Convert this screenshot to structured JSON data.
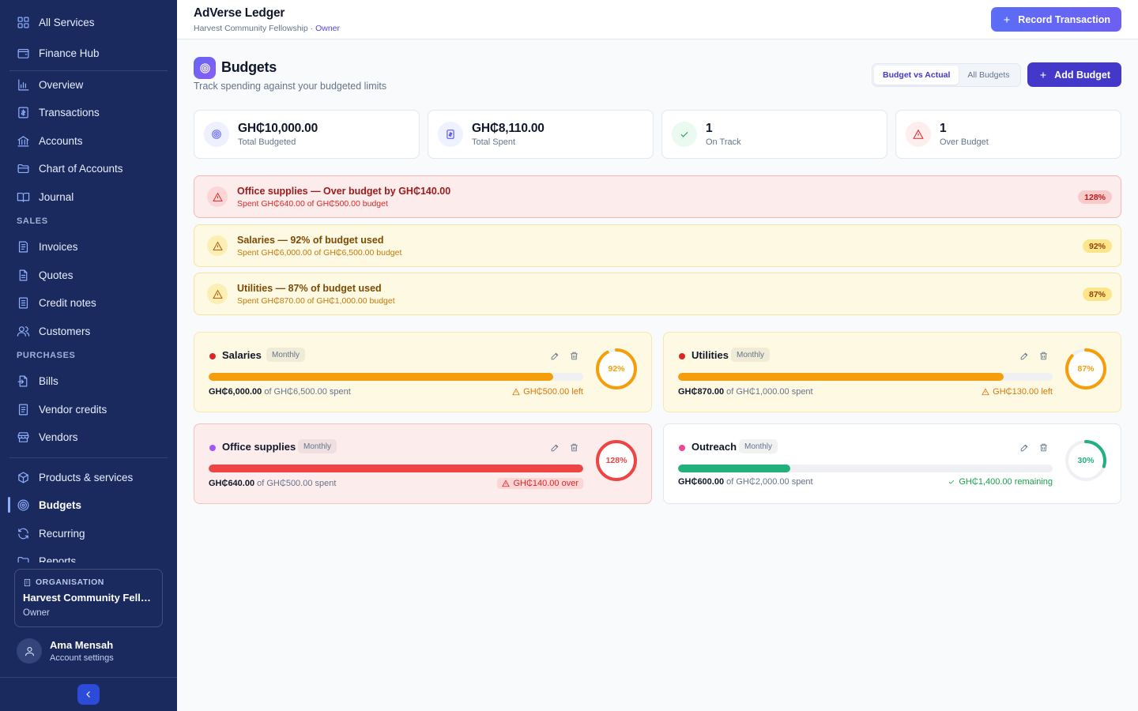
{
  "sidebar": {
    "items": [
      {
        "label": "All Services",
        "icon": "grid-icon"
      },
      {
        "label": "Finance Hub",
        "icon": "wallet-icon"
      },
      {
        "label": "Overview",
        "icon": "bar-chart-icon"
      },
      {
        "label": "Transactions",
        "icon": "receipt-icon"
      },
      {
        "label": "Accounts",
        "icon": "bank-icon"
      },
      {
        "label": "Chart of Accounts",
        "icon": "folder-icon"
      },
      {
        "label": "Journal",
        "icon": "book-icon"
      },
      {
        "label": "Invoices",
        "icon": "invoice-icon"
      },
      {
        "label": "Quotes",
        "icon": "document-icon"
      },
      {
        "label": "Credit notes",
        "icon": "note-icon"
      },
      {
        "label": "Customers",
        "icon": "users-icon"
      },
      {
        "label": "Bills",
        "icon": "bill-icon"
      },
      {
        "label": "Vendor credits",
        "icon": "vendor-credit-icon"
      },
      {
        "label": "Vendors",
        "icon": "store-icon"
      },
      {
        "label": "Products & services",
        "icon": "box-icon"
      },
      {
        "label": "Budgets",
        "icon": "target-icon"
      },
      {
        "label": "Recurring",
        "icon": "refresh-icon"
      },
      {
        "label": "Reports",
        "icon": "reports-icon"
      }
    ],
    "sections": {
      "sales": "SALES",
      "purchases": "PURCHASES"
    },
    "org": {
      "tag": "ORGANISATION",
      "name": "Harvest Community Fello...",
      "role": "Owner"
    },
    "user": {
      "name": "Ama Mensah",
      "sub": "Account settings"
    }
  },
  "header": {
    "title": "AdVerse Ledger",
    "org": "Harvest Community Fellowship",
    "separator": " · ",
    "role": "Owner",
    "record_label": "Record Transaction"
  },
  "page": {
    "title": "Budgets",
    "subtitle": "Track spending against your budgeted limits",
    "view_tabs": [
      "Budget vs Actual",
      "All Budgets"
    ],
    "add_label": "Add Budget"
  },
  "stats": [
    {
      "value": "GH₵10,000.00",
      "label": "Total Budgeted",
      "color": "#6366f1"
    },
    {
      "value": "GH₵8,110.00",
      "label": "Total Spent",
      "color": "#4f46e5"
    },
    {
      "value": "1",
      "label": "On Track",
      "color": "#16a34a"
    },
    {
      "value": "1",
      "label": "Over Budget",
      "color": "#dc2626"
    }
  ],
  "alerts": [
    {
      "title": "Office supplies — Over budget by GH₵140.00",
      "sub": "Spent GH₵640.00 of GH₵500.00 budget",
      "pct": "128%",
      "level": "red"
    },
    {
      "title": "Salaries — 92% of budget used",
      "sub": "Spent GH₵6,000.00 of GH₵6,500.00 budget",
      "pct": "92%",
      "level": "amber"
    },
    {
      "title": "Utilities — 87% of budget used",
      "sub": "Spent GH₵870.00 of GH₵1,000.00 budget",
      "pct": "87%",
      "level": "amber"
    }
  ],
  "budgets": [
    {
      "name": "Salaries",
      "freq": "Monthly",
      "spent": "GH₵6,000.00",
      "of_text": " of GH₵6,500.00 spent",
      "status": "GH₵500.00 left",
      "pct_label": "92%",
      "pct": 92,
      "dot": "#dc2626",
      "bar": "#f59e0b",
      "ring": "#f59e0b",
      "style": "amber",
      "status_color": "#d97706"
    },
    {
      "name": "Utilities",
      "freq": "Monthly",
      "spent": "GH₵870.00",
      "of_text": " of GH₵1,000.00 spent",
      "status": "GH₵130.00 left",
      "pct_label": "87%",
      "pct": 87,
      "dot": "#dc2626",
      "bar": "#f59e0b",
      "ring": "#f59e0b",
      "style": "amber",
      "status_color": "#d97706"
    },
    {
      "name": "Office supplies",
      "freq": "Monthly",
      "spent": "GH₵640.00",
      "of_text": " of GH₵500.00 spent",
      "status": "GH₵140.00 over",
      "pct_label": "128%",
      "pct": 128,
      "dot": "#a855f7",
      "bar": "#ef4444",
      "ring": "#ef4444",
      "style": "red",
      "status_color": "#dc2626"
    },
    {
      "name": "Outreach",
      "freq": "Monthly",
      "spent": "GH₵600.00",
      "of_text": " of GH₵2,000.00 spent",
      "status": "GH₵1,400.00 remaining",
      "pct_label": "30%",
      "pct": 30,
      "dot": "#ec4899",
      "bar": "#22b07d",
      "ring": "#22b07d",
      "style": "white",
      "status_color": "#16a34a"
    }
  ]
}
